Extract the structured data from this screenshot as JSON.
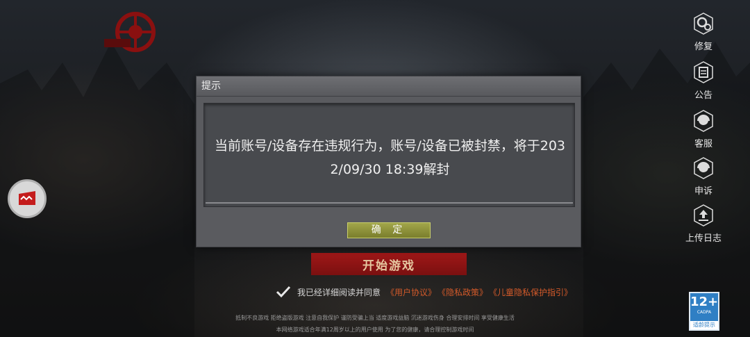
{
  "dialog": {
    "title": "提示",
    "message": "当前账号/设备存在违规行为，账号/设备已被封禁，将于2032/09/30 18:39解封",
    "message_line1": "当前账号/设备存在违规行为，账号/设备已被封禁，将于203",
    "message_line2": "2/09/30 18:39解封",
    "ok_label": "确 定"
  },
  "sidebar": {
    "items": [
      {
        "label": "修复",
        "icon": "gear-icon"
      },
      {
        "label": "公告",
        "icon": "notice-icon"
      },
      {
        "label": "客服",
        "icon": "headset-icon"
      },
      {
        "label": "申诉",
        "icon": "headset-icon"
      },
      {
        "label": "上传日志",
        "icon": "upload-icon"
      }
    ]
  },
  "start_label": "开始游戏",
  "agreement": {
    "prefix": "我已经详细阅读并同意",
    "links": [
      "《用户协议》",
      "《隐私政策》",
      "《儿童隐私保护指引》"
    ]
  },
  "notice_line1": "抵制不良游戏 拒绝盗版游戏 注意自我保护 谨防受骗上当 适度游戏益脑 沉迷游戏伤身 合理安排时间 享受健康生活",
  "notice_line2": "本网络游戏适合年满12周岁以上的用户使用    为了您的健康，请合理控制游戏时间",
  "age_rating": {
    "label": "12+",
    "org": "CADPA",
    "caption": "适龄提示"
  },
  "colors": {
    "accent_red": "#a01818",
    "link": "#d35a2a",
    "ok_button": "#8e9238",
    "age_badge": "#2f7fc4"
  }
}
